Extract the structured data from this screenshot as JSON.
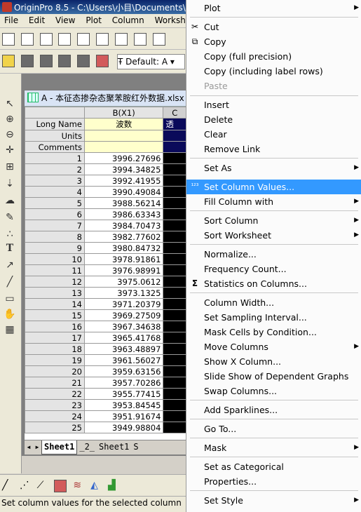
{
  "app": {
    "title": "OriginPro 8.5 - C:\\Users\\小目\\Documents\\"
  },
  "menubar": [
    "File",
    "Edit",
    "View",
    "Plot",
    "Column",
    "Workshe"
  ],
  "toolbar": {
    "font_name": "Default: A",
    "font_size": "9"
  },
  "workbook": {
    "title": "A - 本征态掺杂态聚苯胺红外数据.xlsx",
    "columns": {
      "b_header": "B(X1)",
      "c_header": "C"
    },
    "header_rows": [
      {
        "label": "Long Name",
        "b_value": "波数",
        "c_value": "透"
      },
      {
        "label": "Units",
        "b_value": "",
        "c_value": ""
      },
      {
        "label": "Comments",
        "b_value": "",
        "c_value": ""
      }
    ],
    "rows": [
      {
        "n": "1",
        "v": "3996.27696"
      },
      {
        "n": "2",
        "v": "3994.34825"
      },
      {
        "n": "3",
        "v": "3992.41955"
      },
      {
        "n": "4",
        "v": "3990.49084"
      },
      {
        "n": "5",
        "v": "3988.56214"
      },
      {
        "n": "6",
        "v": "3986.63343"
      },
      {
        "n": "7",
        "v": "3984.70473"
      },
      {
        "n": "8",
        "v": "3982.77602"
      },
      {
        "n": "9",
        "v": "3980.84732"
      },
      {
        "n": "10",
        "v": "3978.91861"
      },
      {
        "n": "11",
        "v": "3976.98991"
      },
      {
        "n": "12",
        "v": "3975.0612"
      },
      {
        "n": "13",
        "v": "3973.1325"
      },
      {
        "n": "14",
        "v": "3971.20379"
      },
      {
        "n": "15",
        "v": "3969.27509"
      },
      {
        "n": "16",
        "v": "3967.34638"
      },
      {
        "n": "17",
        "v": "3965.41768"
      },
      {
        "n": "18",
        "v": "3963.48897"
      },
      {
        "n": "19",
        "v": "3961.56027"
      },
      {
        "n": "20",
        "v": "3959.63156"
      },
      {
        "n": "21",
        "v": "3957.70286"
      },
      {
        "n": "22",
        "v": "3955.77415"
      },
      {
        "n": "23",
        "v": "3953.84545"
      },
      {
        "n": "24",
        "v": "3951.91674"
      },
      {
        "n": "25",
        "v": "3949.98804"
      }
    ],
    "sheet_tabs": [
      "Sheet1",
      "_2_",
      "Sheet1",
      "S"
    ]
  },
  "status": {
    "text": "Set column values for the selected column"
  },
  "context_menu": {
    "plot": "Plot",
    "cut": "Cut",
    "copy": "Copy",
    "copy_full": "Copy (full precision)",
    "copy_label": "Copy (including label rows)",
    "paste": "Paste",
    "insert": "Insert",
    "delete": "Delete",
    "clear": "Clear",
    "remove_link": "Remove Link",
    "set_as": "Set As",
    "set_col_values": "Set Column Values...",
    "fill_column": "Fill Column with",
    "sort_column": "Sort Column",
    "sort_worksheet": "Sort Worksheet",
    "normalize": "Normalize...",
    "freq_count": "Frequency Count...",
    "statistics": "Statistics on Columns...",
    "col_width": "Column Width...",
    "sampling": "Set Sampling Interval...",
    "mask_cells": "Mask Cells by Condition...",
    "move_cols": "Move Columns",
    "show_x": "Show X Column...",
    "slide_show": "Slide Show of Dependent Graphs",
    "swap_cols": "Swap Columns...",
    "sparklines": "Add Sparklines...",
    "goto": "Go To...",
    "mask": "Mask",
    "categorical": "Set as Categorical",
    "properties": "Properties...",
    "set_style": "Set Style"
  },
  "colors": {
    "highlight": "#3399ff",
    "titlebar": "#0a246a"
  }
}
